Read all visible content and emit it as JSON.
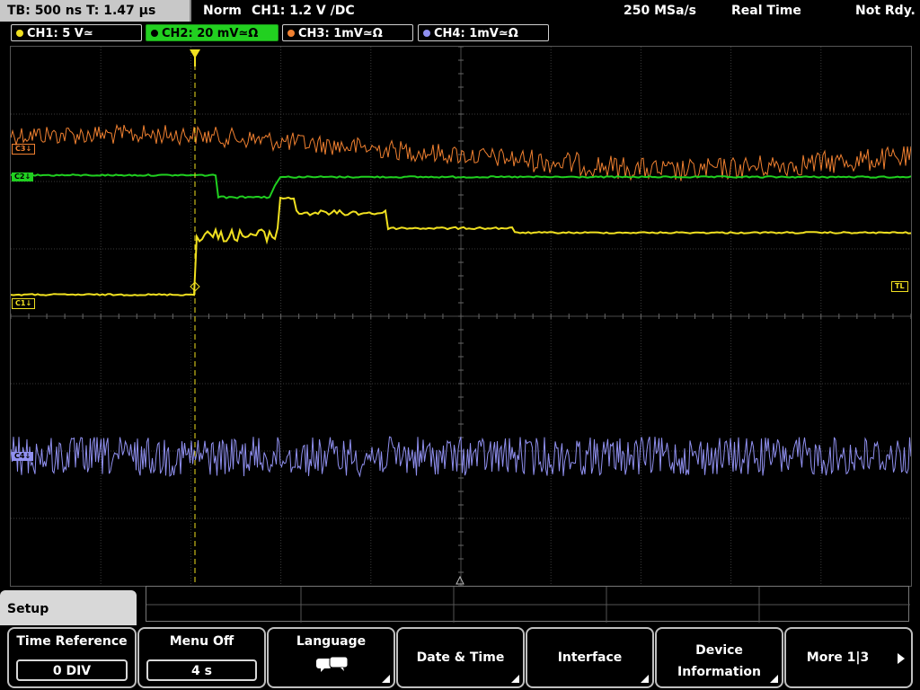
{
  "status": {
    "timebase": "TB: 500 ns   T: 1.47 µs",
    "mode": "Norm",
    "trigger": "CH1: 1.2 V ∕DC",
    "sample_rate": "250 MSa/s",
    "acquisition": "Real Time",
    "state": "Not Rdy."
  },
  "channels": [
    {
      "label": "CH1: 5 V≃",
      "color": "#f0e020"
    },
    {
      "label": "CH2: 20 mV≃Ω",
      "color": "#20d020"
    },
    {
      "label": "CH3: 1mV≃Ω",
      "color": "#f08030"
    },
    {
      "label": "CH4: 1mV≃Ω",
      "color": "#9090f0"
    }
  ],
  "markers": {
    "c3": "C3↓",
    "c2": "C2↓",
    "c1": "C1↓",
    "c4": "C4↓",
    "trigger_level": "TL"
  },
  "menu": {
    "title": "Setup",
    "time_reference_label": "Time Reference",
    "time_reference_value": "0 DIV",
    "menu_off_label": "Menu Off",
    "menu_off_value": "4 s",
    "language_label": "Language",
    "date_time_label": "Date & Time",
    "interface_label": "Interface",
    "device_info_label": "Device Information",
    "more_label": "More 1|3"
  },
  "colors": {
    "ch1": "#f0e020",
    "ch2": "#20d020",
    "ch3": "#f08030",
    "ch4": "#9090f0"
  }
}
